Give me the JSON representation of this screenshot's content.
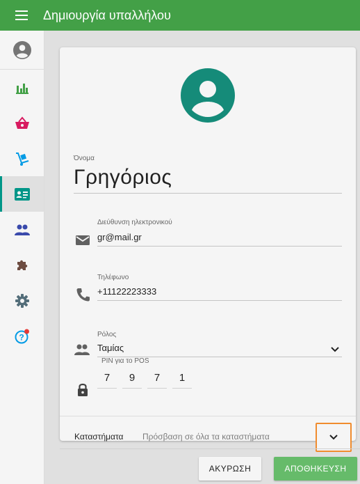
{
  "topbar": {
    "title": "Δημιουργία υπαλλήλου"
  },
  "colors": {
    "brand": "#43a047",
    "accent": "#009688",
    "save": "#66bb6a",
    "highlight": "#f08c2e"
  },
  "sidebar": {
    "items": [
      {
        "icon": "bar-chart-icon",
        "color": "#43a047"
      },
      {
        "icon": "basket-icon",
        "color": "#d81b60"
      },
      {
        "icon": "hand-truck-icon",
        "color": "#039be5"
      },
      {
        "icon": "contact-card-icon",
        "color": "#009688",
        "active": true
      },
      {
        "icon": "people-icon",
        "color": "#3949ab"
      },
      {
        "icon": "puzzle-icon",
        "color": "#6d4c41"
      },
      {
        "icon": "gear-icon",
        "color": "#546e7a"
      },
      {
        "icon": "help-icon",
        "color": "#039be5",
        "badge": true
      }
    ]
  },
  "form": {
    "name_label": "Όνομα",
    "name_value": "Γρηγόριος",
    "email_label": "Διεύθυνση ηλεκτρονικού",
    "email_value": "gr@mail.gr",
    "phone_label": "Τηλέφωνο",
    "phone_value": "+11122223333",
    "role_label": "Ρόλος",
    "role_value": "Ταμίας",
    "pin_label": "PIN για το POS",
    "pin_digits": [
      "7",
      "9",
      "7",
      "1"
    ],
    "stores_label": "Καταστήματα",
    "stores_value": "Πρόσβαση σε όλα τα καταστήματα"
  },
  "actions": {
    "cancel": "ΑΚΥΡΩΣΗ",
    "save": "ΑΠΟΘΗΚΕΥΣΗ"
  }
}
